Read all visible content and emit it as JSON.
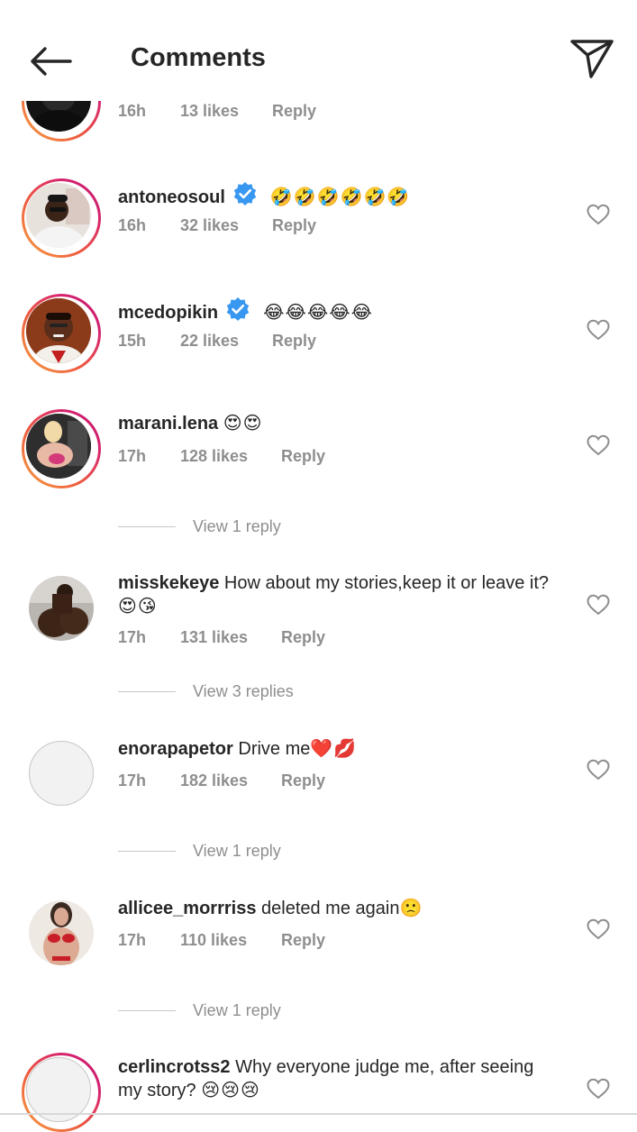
{
  "header": {
    "title": "Comments",
    "back_icon": "arrow-left-icon",
    "share_icon": "paper-plane-icon"
  },
  "colors": {
    "text": "#262626",
    "secondary": "#8e8e8e",
    "verified": "#3897f0",
    "story_ring": "#d6246f"
  },
  "comments": [
    {
      "username": "",
      "text": "",
      "time": "16h",
      "likes": "13 likes",
      "reply": "Reply",
      "partial": true
    },
    {
      "username": "antoneosoul",
      "verified": true,
      "text": "",
      "emoji": "🤣🤣🤣🤣🤣🤣",
      "time": "16h",
      "likes": "32 likes",
      "reply": "Reply"
    },
    {
      "username": "mcedopikin",
      "verified": true,
      "text": "",
      "emoji": "😂😂😂😂😂",
      "time": "15h",
      "likes": "22 likes",
      "reply": "Reply"
    },
    {
      "username": "marani.lena",
      "text": "",
      "emoji": "😍😍",
      "time": "17h",
      "likes": "128 likes",
      "reply": "Reply",
      "view_replies": "View 1 reply"
    },
    {
      "username": "misskekeye",
      "text": "How about my stories,keep it or leave it?",
      "emoji": "😍😘",
      "time": "17h",
      "likes": "131 likes",
      "reply": "Reply",
      "view_replies": "View 3 replies"
    },
    {
      "username": "enorapapetor",
      "text": "Drive me",
      "emoji": "❤️💋",
      "time": "17h",
      "likes": "182 likes",
      "reply": "Reply",
      "view_replies": "View 1 reply"
    },
    {
      "username": "allicee_morrriss",
      "text": "deleted me again",
      "emoji": "🙁",
      "time": "17h",
      "likes": "110 likes",
      "reply": "Reply",
      "view_replies": "View 1 reply"
    },
    {
      "username": "cerlincrotss2",
      "text": "Why everyone judge me, after seeing my story?",
      "emoji": "😢😢😢"
    }
  ]
}
